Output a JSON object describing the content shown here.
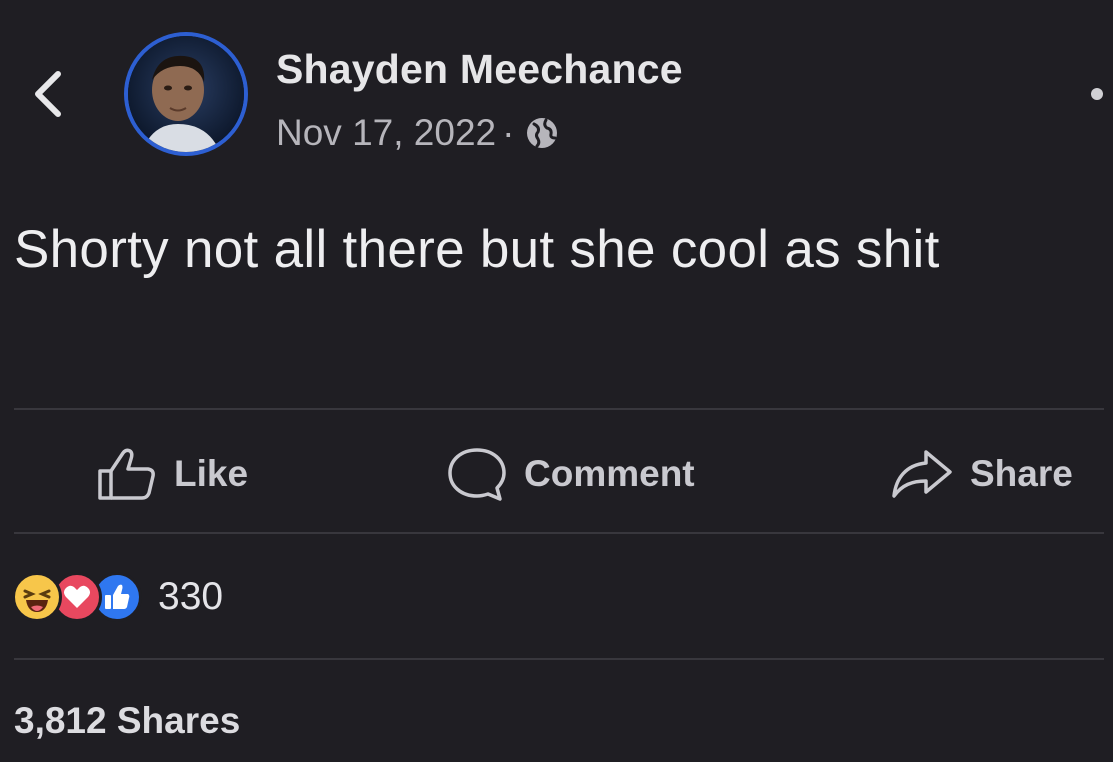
{
  "post": {
    "author": "Shayden Meechance",
    "date": "Nov 17, 2022",
    "separator": "·",
    "audience_icon": "globe-icon",
    "text": "Shorty not all there but she cool as shit"
  },
  "actions": {
    "like_label": "Like",
    "comment_label": "Comment",
    "share_label": "Share"
  },
  "stats": {
    "reactions": [
      "haha",
      "love",
      "like"
    ],
    "reaction_count": "330",
    "shares": "3,812 Shares"
  },
  "colors": {
    "background": "#1f1e23",
    "avatar_ring": "#2d5fd2",
    "like_reaction": "#2f77f0",
    "love_reaction": "#e8485f",
    "haha_reaction": "#f7c64a"
  }
}
